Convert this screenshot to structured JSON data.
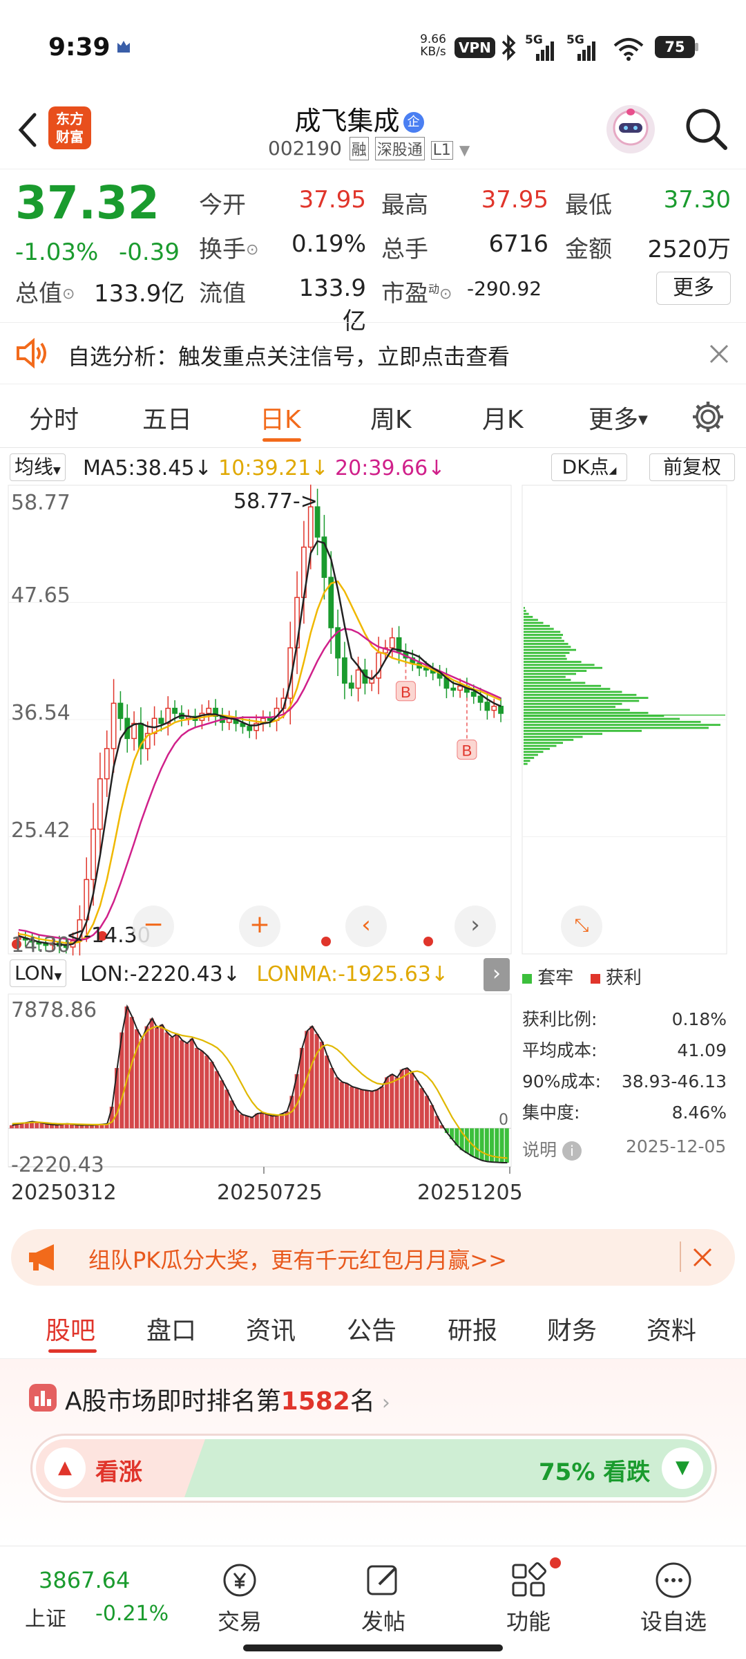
{
  "status_bar": {
    "time": "9:39",
    "net_speed_value": "9.66",
    "net_speed_unit": "KB/s",
    "vpn": "VPN",
    "signal1": "5G",
    "signal2": "5G",
    "battery": "75"
  },
  "header": {
    "back_icon": "chevron-left-icon",
    "brand_line1": "东方",
    "brand_line2": "财富",
    "stock_name": "成飞集成",
    "stock_code": "002190",
    "tag_rong": "融",
    "tag_sgt": "深股通",
    "tag_l1": "L1",
    "badge": "企",
    "search_icon": "search-icon"
  },
  "quote": {
    "price": "37.32",
    "change_pct": "-1.03%",
    "change": "-0.39",
    "open_label": "今开",
    "open": "37.95",
    "high_label": "最高",
    "high": "37.95",
    "low_label": "最低",
    "low": "37.30",
    "turnover_label": "换手",
    "turnover": "0.19%",
    "volume_label": "总手",
    "volume": "6716",
    "amount_label": "金额",
    "amount": "2520万",
    "mktcap_label": "总值",
    "mktcap": "133.9亿",
    "float_label": "流值",
    "float": "133.9亿",
    "pe_label": "市盈",
    "pe_sup": "动",
    "pe": "-290.92",
    "more": "更多"
  },
  "notice": {
    "text": "自选分析：触发重点关注信号，立即点击查看"
  },
  "tabs": [
    "分时",
    "五日",
    "日K",
    "周K",
    "月K",
    "更多"
  ],
  "active_tab": 2,
  "indicators": {
    "ma_type": "均线",
    "ma5": "MA5:38.45",
    "ma10": "10:39.21",
    "ma20": "20:39.66",
    "dk": "DK点",
    "fq": "前复权"
  },
  "colors": {
    "ma5": "#222222",
    "ma10": "#f0b800",
    "ma20": "#d0208a",
    "up": "#e0352b",
    "down": "#1a9b2e",
    "accent": "#f26a1b"
  },
  "chart_data": [
    {
      "type": "candlestick",
      "y_ticks": [
        "58.77",
        "47.65",
        "36.54",
        "25.42",
        "14.30"
      ],
      "ylim": [
        14.3,
        58.77
      ],
      "max_label": "58.77->",
      "min_label": "<-14.30",
      "x_labels": [
        "20250312",
        "20250725",
        "20251205"
      ],
      "buy_markers": [
        "B",
        "B"
      ],
      "close": [
        15.2,
        15.0,
        14.8,
        14.6,
        14.5,
        14.7,
        14.4,
        14.3,
        14.9,
        17,
        21,
        26,
        31,
        34,
        38.5,
        37,
        35,
        36.5,
        34,
        35.5,
        37,
        36.5,
        38,
        37.5,
        37,
        37.2,
        36.8,
        37.5,
        38,
        37.2,
        36.6,
        37,
        36.5,
        36.2,
        35.8,
        36.5,
        37,
        36.8,
        38,
        39,
        44,
        49,
        54,
        58,
        55,
        51,
        46,
        43,
        40.5,
        40,
        41.8,
        40.5,
        41,
        43.5,
        44,
        45,
        43.6,
        43,
        42.5,
        42,
        41.8,
        41.5,
        41,
        40,
        39.8,
        40.2,
        39.6,
        39.2,
        38.6,
        37.8,
        38.2,
        37.5
      ],
      "ma5": [
        15.4,
        15.2,
        15.0,
        14.8,
        14.7,
        14.6,
        14.55,
        14.5,
        14.6,
        15.2,
        16.8,
        19.6,
        23.4,
        27.8,
        32.2,
        35,
        36,
        36.4,
        36.5,
        36.2,
        36.1,
        36.3,
        36.6,
        37,
        37.3,
        37.2,
        37.1,
        37.3,
        37.4,
        37.4,
        37.2,
        37.0,
        36.9,
        36.6,
        36.3,
        36.3,
        36.5,
        36.6,
        37.2,
        38,
        40.6,
        44.4,
        49,
        53.4,
        54.6,
        54.4,
        52.8,
        49.8,
        46.2,
        43,
        42.2,
        41.2,
        40.9,
        41.6,
        42.8,
        43.9,
        43.8,
        43.6,
        43.4,
        43.1,
        42.5,
        42,
        41.6,
        41,
        40.5,
        40.3,
        40,
        39.8,
        39.4,
        38.9,
        38.5,
        38.2
      ],
      "ma10": [
        15.6,
        15.5,
        15.3,
        15.1,
        15.0,
        14.9,
        14.8,
        14.7,
        14.7,
        14.8,
        15.4,
        16.6,
        18.4,
        21,
        24.2,
        27.6,
        30.4,
        32.8,
        34.4,
        35.3,
        35.6,
        35.9,
        36.2,
        36.6,
        36.8,
        36.9,
        37.0,
        37.1,
        37.2,
        37.3,
        37.3,
        37.2,
        37.1,
        36.9,
        36.8,
        36.7,
        36.6,
        36.6,
        36.8,
        37.2,
        38.2,
        40,
        42.6,
        45.5,
        47.8,
        49.5,
        50.4,
        50.6,
        49.6,
        48.2,
        46.8,
        45.4,
        44.2,
        43.6,
        43.4,
        43,
        42.8,
        42.6,
        42.4,
        42.3,
        42.1,
        41.8,
        41.5,
        41.2,
        40.8,
        40.5,
        40.2,
        39.9,
        39.7,
        39.4,
        39.1,
        38.8
      ],
      "ma20": [
        16,
        15.9,
        15.7,
        15.5,
        15.4,
        15.3,
        15.2,
        15.1,
        15.0,
        15.0,
        15.1,
        15.5,
        16.2,
        17.3,
        18.8,
        20.6,
        22.6,
        24.6,
        26.7,
        28.6,
        30.4,
        32,
        33.4,
        34.5,
        35.3,
        35.8,
        36.1,
        36.3,
        36.5,
        36.7,
        36.9,
        37.0,
        37.0,
        37.1,
        37.1,
        37.1,
        37.1,
        37.1,
        37.2,
        37.4,
        37.9,
        38.7,
        39.9,
        41.3,
        42.7,
        43.9,
        44.9,
        45.6,
        45.9,
        45.8,
        45.5,
        45,
        44.5,
        44.1,
        43.9,
        43.7,
        43.5,
        43.2,
        42.9,
        42.6,
        42.3,
        42,
        41.7,
        41.4,
        41.1,
        40.8,
        40.5,
        40.2,
        39.9,
        39.6,
        39.3,
        39.0
      ]
    },
    {
      "type": "bar",
      "name": "LON",
      "lon_label": "LON:-2220.43",
      "lonma_label": "LONMA:-1925.63",
      "y_ticks": [
        "7878.86",
        "-2220.43"
      ],
      "ylim": [
        -2220.43,
        7878.86
      ],
      "zero_label": "0",
      "values": [
        200,
        260,
        320,
        380,
        440,
        400,
        350,
        280,
        240,
        220,
        260,
        300,
        260,
        220,
        200,
        220,
        200,
        230,
        260,
        290,
        1400,
        3900,
        6200,
        7878,
        7200,
        6400,
        5800,
        6600,
        7100,
        6500,
        6700,
        6200,
        5900,
        6100,
        5700,
        5500,
        5800,
        5200,
        5000,
        4700,
        4300,
        3700,
        3100,
        2500,
        1800,
        1200,
        900,
        800,
        700,
        950,
        1000,
        900,
        800,
        820,
        950,
        1100,
        2100,
        3500,
        5200,
        6300,
        6600,
        6100,
        5600,
        4700,
        3900,
        3300,
        3000,
        2900,
        2700,
        2600,
        2500,
        2450,
        2400,
        2500,
        2700,
        3300,
        3500,
        3300,
        3800,
        3900,
        3600,
        3100,
        2600,
        2100,
        1500,
        800,
        200,
        -300,
        -700,
        -1100,
        -1400,
        -1600,
        -1800,
        -1950,
        -2080,
        -2150,
        -2180,
        -2200,
        -2220,
        -2220
      ],
      "lonma": [
        300,
        320,
        340,
        360,
        380,
        400,
        380,
        350,
        320,
        300,
        290,
        290,
        280,
        270,
        260,
        250,
        245,
        240,
        245,
        250,
        420,
        1000,
        2000,
        3200,
        4300,
        5200,
        5900,
        6300,
        6500,
        6600,
        6500,
        6350,
        6200,
        6100,
        6000,
        5950,
        5900,
        5800,
        5700,
        5550,
        5400,
        5200,
        4900,
        4500,
        4000,
        3400,
        2800,
        2200,
        1700,
        1300,
        1050,
        950,
        900,
        860,
        860,
        900,
        1100,
        1600,
        2400,
        3300,
        4200,
        4900,
        5300,
        5400,
        5300,
        5100,
        4800,
        4450,
        4100,
        3800,
        3500,
        3250,
        3050,
        2900,
        2850,
        2900,
        3000,
        3150,
        3300,
        3500,
        3650,
        3700,
        3600,
        3350,
        3000,
        2500,
        1900,
        1300,
        700,
        200,
        -300,
        -700,
        -1050,
        -1350,
        -1550,
        -1700,
        -1800,
        -1860,
        -1900,
        -1925
      ]
    },
    {
      "type": "bar",
      "name": "chip-distribution",
      "legend_trapped": "套牢",
      "legend_profit": "获利",
      "stats": [
        {
          "label": "获利比例:",
          "value": "0.18%"
        },
        {
          "label": "平均成本:",
          "value": "41.09"
        },
        {
          "label": "90%成本:",
          "value": "38.93-46.13"
        },
        {
          "label": "集中度:",
          "value": "8.46%"
        }
      ],
      "note_label": "说明",
      "date": "2025-12-05",
      "bars": [
        2,
        4,
        8,
        14,
        22,
        30,
        40,
        46,
        56,
        60,
        58,
        62,
        68,
        72,
        80,
        70,
        64,
        66,
        88,
        108,
        120,
        96,
        80,
        64,
        72,
        94,
        118,
        132,
        150,
        172,
        190,
        176,
        150,
        140,
        162,
        190,
        214,
        238,
        270,
        300,
        282,
        180,
        120,
        90,
        76,
        60,
        50,
        40,
        30,
        22,
        16,
        10,
        6
      ]
    }
  ],
  "banner": {
    "text": "组队PK瓜分大奖，更有千元红包月月赢>>"
  },
  "sub_tabs": [
    "股吧",
    "盘口",
    "资讯",
    "公告",
    "研报",
    "财务",
    "资料"
  ],
  "rank": {
    "prefix": "A股市场即时排名第",
    "num": "1582",
    "suffix": "名",
    "bull_label": "看涨",
    "bear_label": "75% 看跌",
    "bull_share": 0.25
  },
  "bottom_nav": {
    "index_value": "3867.64",
    "index_name": "上证",
    "index_change": "-0.21%",
    "trade": "交易",
    "post": "发帖",
    "func": "功能",
    "watch": "设自选"
  }
}
